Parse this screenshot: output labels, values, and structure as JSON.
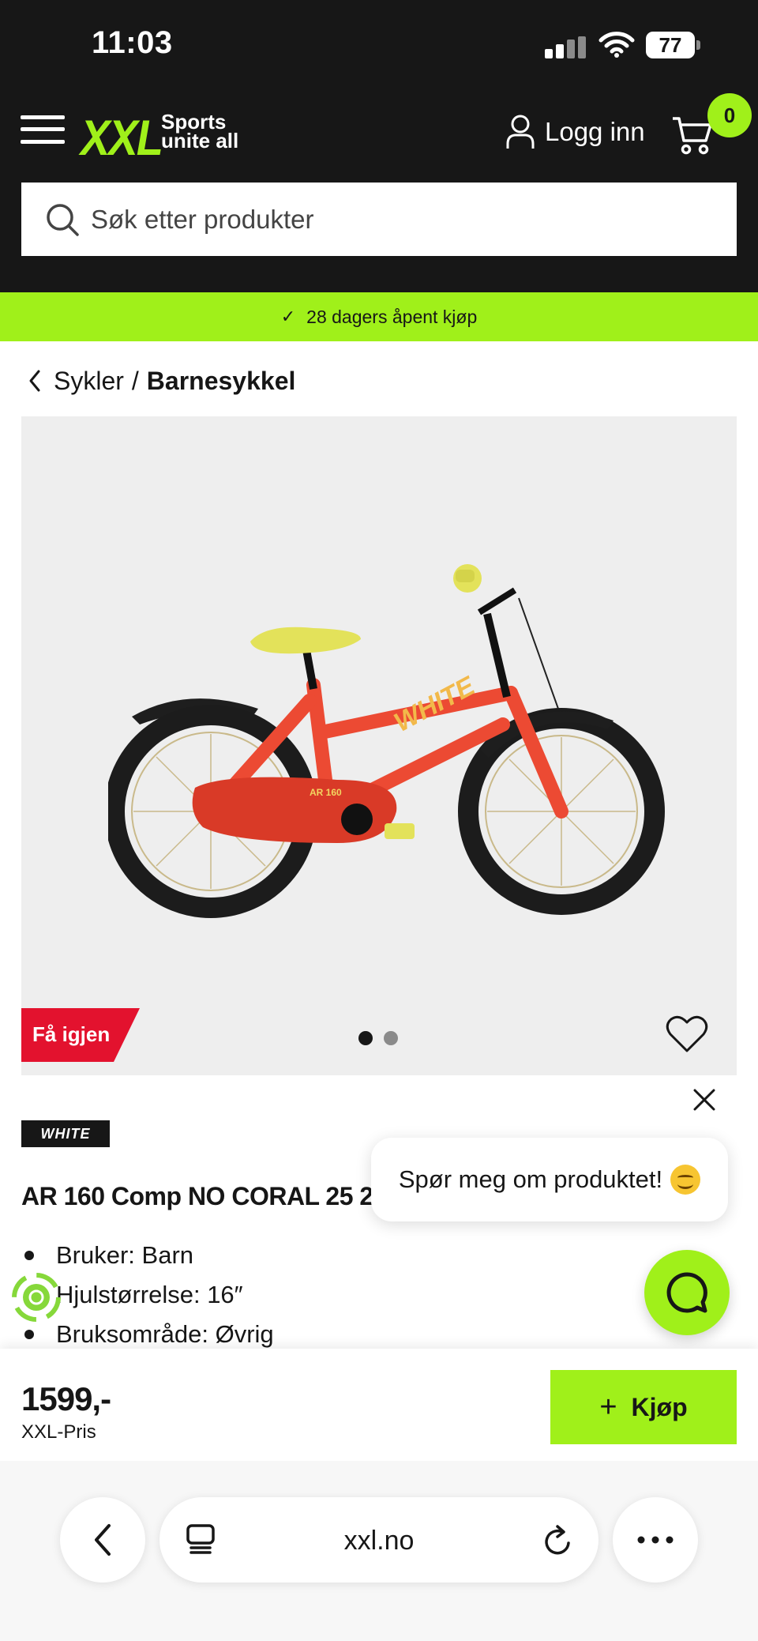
{
  "status_bar": {
    "time": "11:03",
    "battery": "77"
  },
  "header": {
    "logo_text": "XXL",
    "logo_tagline": "Sports unite all",
    "login_label": "Logg inn",
    "cart_count": "0"
  },
  "search": {
    "placeholder": "Søk etter produkter"
  },
  "promo": {
    "text": "28 dagers åpent kjøp"
  },
  "breadcrumb": {
    "parent": "Sykler",
    "separator": "/",
    "current": "Barnesykkel"
  },
  "gallery": {
    "badge": "Få igjen",
    "image_count": 2,
    "active_index": 0
  },
  "product": {
    "brand": "WHITE",
    "title": "AR 160 Comp NO CORAL 25 2",
    "features": [
      "Bruker: Barn",
      "Hjulstørrelse: 16″",
      "Bruksområde: Øvrig"
    ]
  },
  "chat": {
    "prompt": "Spør meg om produktet!"
  },
  "buy_bar": {
    "price": "1599,-",
    "price_label": "XXL-Pris",
    "buy_label": "Kjøp"
  },
  "browser": {
    "url": "xxl.no"
  },
  "colors": {
    "brand_green": "#a0f01a",
    "header_bg": "#171717",
    "badge_red": "#e3122e"
  },
  "bike_colors": {
    "frame": "#ec4a33",
    "saddle": "#e3e25a",
    "tire": "#1c1c1c"
  }
}
